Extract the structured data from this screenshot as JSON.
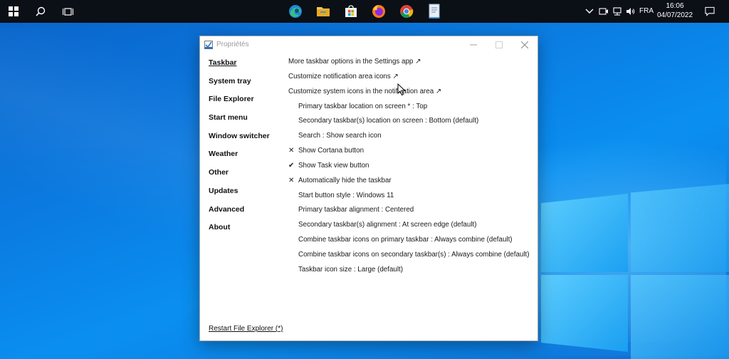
{
  "taskbar": {
    "left_icons": [
      "windows-logo-icon",
      "search-icon",
      "task-view-icon"
    ],
    "pinned_apps": [
      "edge-icon",
      "file-explorer-icon",
      "store-icon",
      "firefox-icon",
      "chrome-icon",
      "document-icon"
    ],
    "tray": {
      "icons": [
        "chevron-up-icon",
        "camera-icon",
        "network-icon",
        "volume-icon"
      ],
      "language": "FRA",
      "time": "16:06",
      "date": "04/07/2022"
    }
  },
  "window": {
    "title": "Propriétés",
    "sidebar": [
      {
        "label": "Taskbar",
        "active": true
      },
      {
        "label": "System tray"
      },
      {
        "label": "File Explorer"
      },
      {
        "label": "Start menu"
      },
      {
        "label": "Window switcher"
      },
      {
        "label": "Weather"
      },
      {
        "label": "Other"
      },
      {
        "label": "Updates"
      },
      {
        "label": "Advanced"
      },
      {
        "label": "About"
      }
    ],
    "restart_label": "Restart File Explorer (*)",
    "rows": [
      {
        "text": "More taskbar options in the Settings app ↗",
        "kind": "link"
      },
      {
        "text": "Customize notification area icons ↗",
        "kind": "link"
      },
      {
        "text": "Customize system icons in the notification area ↗",
        "kind": "link"
      },
      {
        "text": "Primary taskbar location on screen * : Top",
        "kind": "opt",
        "mark": ""
      },
      {
        "text": "Secondary taskbar(s) location on screen : Bottom (default)",
        "kind": "opt",
        "mark": ""
      },
      {
        "text": "Search : Show search icon",
        "kind": "opt",
        "mark": ""
      },
      {
        "text": "Show Cortana button",
        "kind": "opt",
        "mark": "✕"
      },
      {
        "text": "Show Task view button",
        "kind": "opt",
        "mark": "✔"
      },
      {
        "text": "Automatically hide the taskbar",
        "kind": "opt",
        "mark": "✕"
      },
      {
        "text": "Start button style : Windows 11",
        "kind": "opt",
        "mark": ""
      },
      {
        "text": "Primary taskbar alignment : Centered",
        "kind": "opt",
        "mark": ""
      },
      {
        "text": "Secondary taskbar(s) alignment : At screen edge (default)",
        "kind": "opt",
        "mark": ""
      },
      {
        "text": "Combine taskbar icons on primary taskbar : Always combine (default)",
        "kind": "opt",
        "mark": ""
      },
      {
        "text": "Combine taskbar icons on secondary taskbar(s) : Always combine (default)",
        "kind": "opt",
        "mark": ""
      },
      {
        "text": "Taskbar icon size : Large (default)",
        "kind": "opt",
        "mark": ""
      }
    ]
  },
  "colors": {
    "taskbar_bg": "#0b0f16",
    "desktop_blue": "#0b7ae0",
    "window_bg": "#ffffff"
  }
}
